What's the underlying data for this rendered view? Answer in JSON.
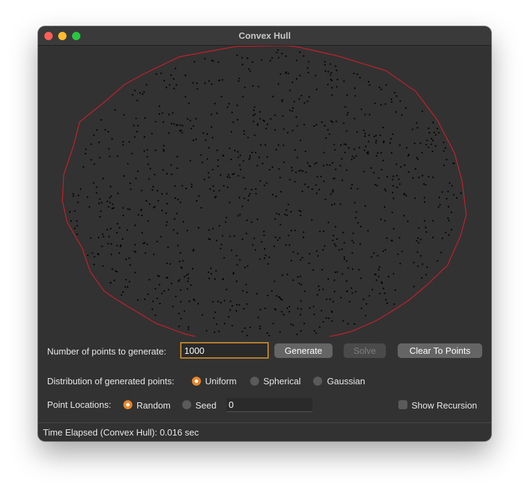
{
  "window": {
    "title": "Convex Hull",
    "traffic_lights": {
      "close": "#ff5f57",
      "minimize": "#febc2e",
      "zoom": "#28c840"
    }
  },
  "canvas": {
    "background": "#333333",
    "hull_color": "#c8202c",
    "point_color": "#000000"
  },
  "controls": {
    "num_points_label": "Number of points to generate:",
    "num_points_value": "1000",
    "generate_label": "Generate",
    "solve_label": "Solve",
    "clear_label": "Clear To Points",
    "distribution_label": "Distribution of generated points:",
    "distribution_options": [
      "Uniform",
      "Spherical",
      "Gaussian"
    ],
    "distribution_selected": "Uniform",
    "locations_label": "Point Locations:",
    "location_options": [
      "Random",
      "Seed"
    ],
    "location_selected": "Random",
    "seed_value": "0",
    "show_recursion_label": "Show Recursion",
    "show_recursion_checked": false,
    "accent_color": "#e8862a"
  },
  "status": {
    "text": "Time Elapsed (Convex Hull): 0.016 sec"
  }
}
